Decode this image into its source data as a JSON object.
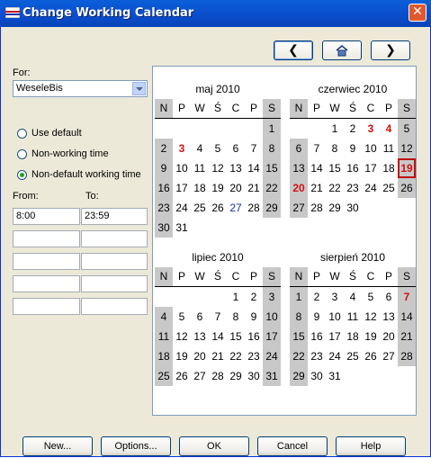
{
  "window": {
    "title": "Change Working Calendar"
  },
  "nav": {
    "prev_icon": "chevron-left-icon",
    "home_icon": "home-icon",
    "next_icon": "chevron-right-icon",
    "prev_glyph": "❮",
    "next_glyph": "❯"
  },
  "left": {
    "for_label": "For:",
    "calendar_select": "WeseleBis",
    "radios": [
      {
        "label": "Use default",
        "checked": false
      },
      {
        "label": "Non-working time",
        "checked": false
      },
      {
        "label": "Non-default working time",
        "checked": true
      }
    ],
    "from_label": "From:",
    "to_label": "To:",
    "rows": [
      {
        "from": "8:00",
        "to": "23:59"
      },
      {
        "from": "",
        "to": ""
      },
      {
        "from": "",
        "to": ""
      },
      {
        "from": "",
        "to": ""
      },
      {
        "from": "",
        "to": ""
      }
    ]
  },
  "day_headers": [
    "N",
    "P",
    "W",
    "Ś",
    "C",
    "P",
    "S"
  ],
  "months": [
    {
      "title": "maj 2010",
      "start": 6,
      "days": 31,
      "red": [
        3
      ],
      "blue": [
        27
      ],
      "today": null
    },
    {
      "title": "czerwiec 2010",
      "start": 2,
      "days": 30,
      "red": [
        3,
        4,
        20
      ],
      "blue": [],
      "today": 19
    },
    {
      "title": "lipiec 2010",
      "start": 4,
      "days": 31,
      "red": [],
      "blue": [],
      "today": null
    },
    {
      "title": "sierpień 2010",
      "start": 0,
      "days": 31,
      "red": [
        7
      ],
      "blue": [],
      "today": null
    }
  ],
  "buttons": {
    "new": "New...",
    "options": "Options...",
    "ok": "OK",
    "cancel": "Cancel",
    "help": "Help"
  },
  "colors": {
    "titlebar": "#0a5fd8",
    "weekend": "#c8c8c8",
    "highlight": "#d01010"
  }
}
